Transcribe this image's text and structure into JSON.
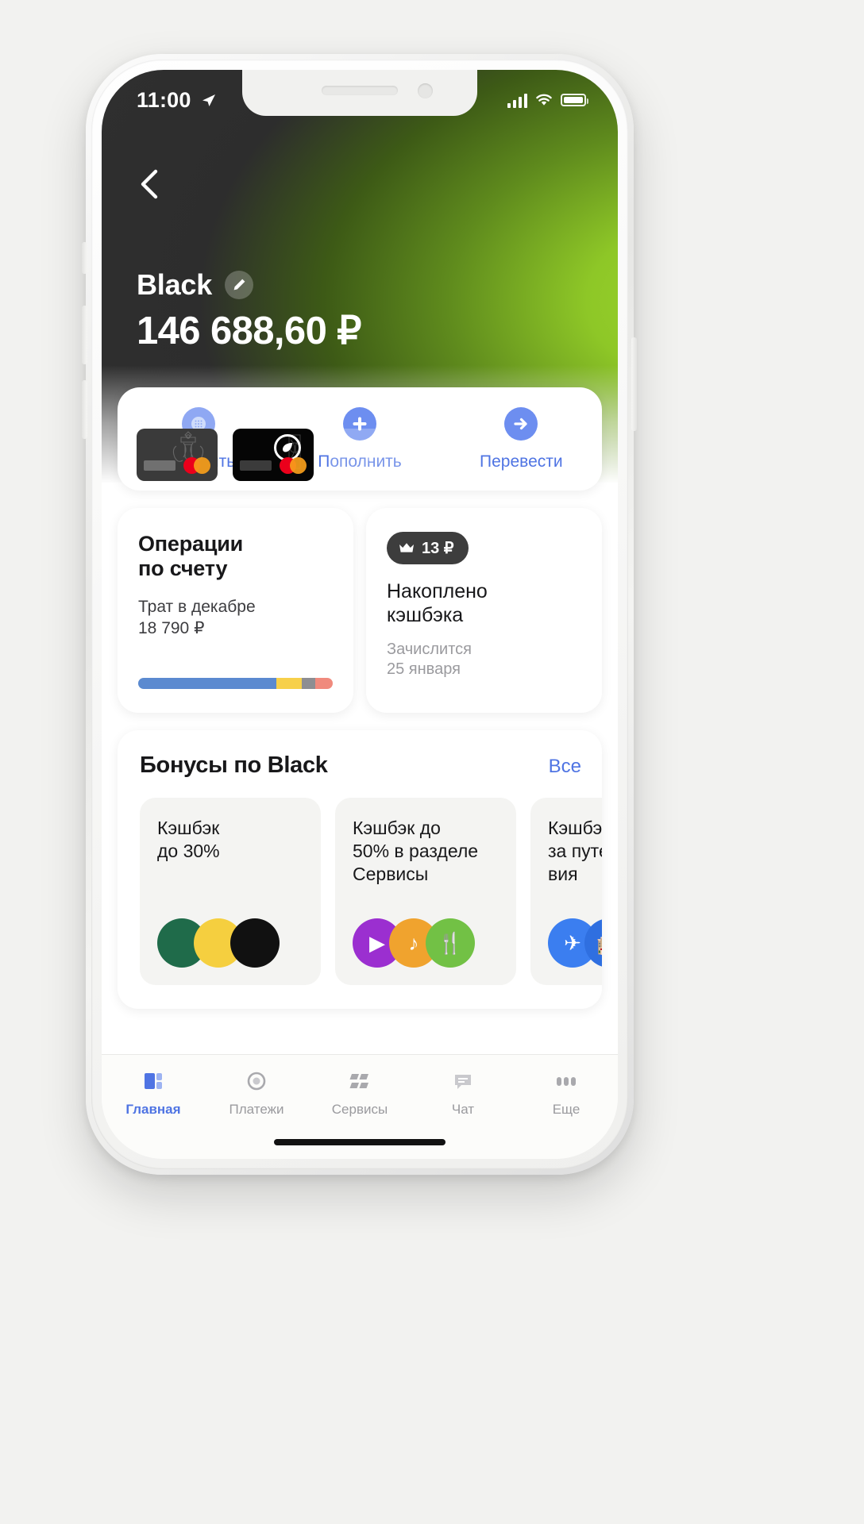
{
  "statusbar": {
    "time": "11:00",
    "location_icon": "location-arrow-icon",
    "signal_icon": "cellular-bars-icon",
    "wifi_icon": "wifi-icon",
    "battery_icon": "battery-full-icon"
  },
  "header": {
    "back_icon": "back-chevron-icon",
    "card_name": "Black",
    "edit_icon": "pencil-icon",
    "balance": "146 688,60 ₽"
  },
  "cards": {
    "thumbnails": [
      {
        "name": "card-thumb-crest",
        "network_icon": "mastercard-icon"
      },
      {
        "name": "card-thumb-black",
        "network_icon": "mastercard-icon",
        "badge_icon": "leaf-icon"
      }
    ],
    "add_label": "+"
  },
  "actions": [
    {
      "label": "Оплатить",
      "icon": "qr-pay-icon"
    },
    {
      "label": "Пополнить",
      "icon": "plus-circle-icon"
    },
    {
      "label": "Перевести",
      "icon": "arrow-right-circle-icon"
    }
  ],
  "operations": {
    "title_line1": "Операции",
    "title_line2": "по счету",
    "sub_line1": "Трат в декабре",
    "sub_line2": "18 790 ₽",
    "progress": [
      {
        "color": "#5b8ad0",
        "pct": 71
      },
      {
        "color": "#f7d04a",
        "pct": 13
      },
      {
        "color": "#8e8e92",
        "pct": 7
      },
      {
        "color": "#f08a7d",
        "pct": 9
      }
    ]
  },
  "cashback": {
    "badge_icon": "crown-icon",
    "badge_value": "13 ₽",
    "title_line1": "Накоплено",
    "title_line2": "кэшбэка",
    "note_line1": "Зачислится",
    "note_line2": "25 января"
  },
  "bonuses": {
    "title": "Бонусы по Black",
    "all_label": "Все",
    "items": [
      {
        "text": "Кэшбэк\nдо 30%",
        "icons": [
          {
            "name": "green-circle-icon",
            "color": "#1f6b4a"
          },
          {
            "name": "yellow-circle-icon",
            "color": "#f5cf3f"
          },
          {
            "name": "black-circle-icon",
            "color": "#111111"
          }
        ]
      },
      {
        "text": "Кэшбэк до\n50% в разделе\nСервисы",
        "icons": [
          {
            "name": "video-icon",
            "color": "#9b2fd0",
            "glyph": "▶"
          },
          {
            "name": "music-icon",
            "color": "#f0a32e",
            "glyph": "♪"
          },
          {
            "name": "food-icon",
            "color": "#72c145",
            "glyph": "🍴"
          }
        ]
      },
      {
        "text": "Кэшбэк\nза путешест\nвия",
        "icons": [
          {
            "name": "plane-icon",
            "color": "#3b7ef0",
            "glyph": "✈"
          },
          {
            "name": "hotel-icon",
            "color": "#2f6fe0",
            "glyph": "🏨"
          }
        ]
      }
    ]
  },
  "tabbar": [
    {
      "label": "Главная",
      "icon": "home-icon",
      "active": true
    },
    {
      "label": "Платежи",
      "icon": "payments-icon",
      "active": false
    },
    {
      "label": "Сервисы",
      "icon": "services-icon",
      "active": false
    },
    {
      "label": "Чат",
      "icon": "chat-icon",
      "active": false
    },
    {
      "label": "Еще",
      "icon": "more-icon",
      "active": false
    }
  ],
  "colors": {
    "accent_blue": "#4f74e3",
    "brand_green": "#9bd62b",
    "dark": "#2d2d2d"
  }
}
